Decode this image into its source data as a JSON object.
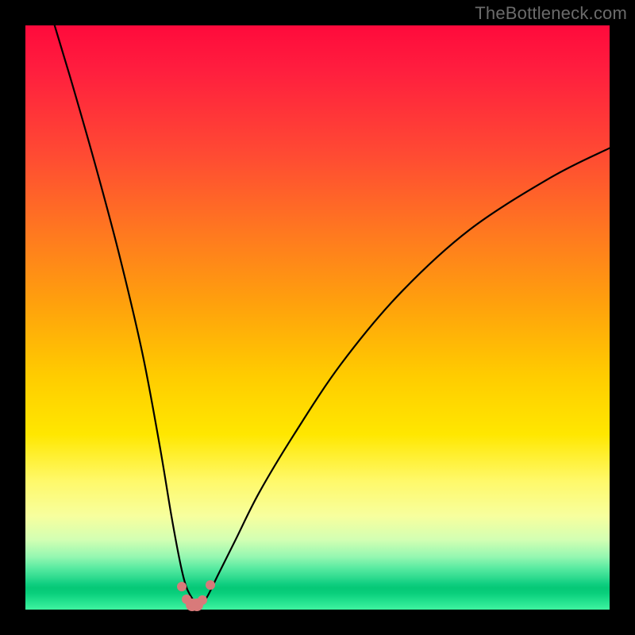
{
  "watermark": "TheBottleneck.com",
  "colors": {
    "background_frame": "#000000",
    "curve": "#000000",
    "marker": "#d87a7a",
    "gradient_top": "#ff0a3c",
    "gradient_bottom": "#3ff3a0"
  },
  "chart_data": {
    "type": "line",
    "title": "",
    "xlabel": "",
    "ylabel": "",
    "xlim": [
      0,
      100
    ],
    "ylim": [
      0,
      100
    ],
    "grid": false,
    "legend": false,
    "note": "V-shaped bottleneck curve; y-axis inverted visually (0 at bottom of colored area). Values are percentage heights read from the gradient position.",
    "series": [
      {
        "name": "left-branch",
        "x": [
          5,
          8,
          12,
          16,
          20,
          23,
          25,
          26.5,
          27.5,
          28.5,
          29.5
        ],
        "y": [
          100,
          90,
          76,
          61,
          44,
          28,
          16,
          8,
          4,
          2,
          0.5
        ]
      },
      {
        "name": "right-branch",
        "x": [
          29.5,
          31,
          33,
          36,
          40,
          46,
          54,
          64,
          76,
          90,
          100
        ],
        "y": [
          0.5,
          2,
          6,
          12,
          20,
          30,
          42,
          54,
          65,
          74,
          79
        ]
      }
    ],
    "markers": {
      "name": "valley-points",
      "x": [
        26.8,
        27.6,
        28.5,
        29.4,
        30.3,
        31.6
      ],
      "y": [
        4.0,
        1.8,
        0.8,
        0.8,
        1.6,
        4.2
      ]
    }
  }
}
